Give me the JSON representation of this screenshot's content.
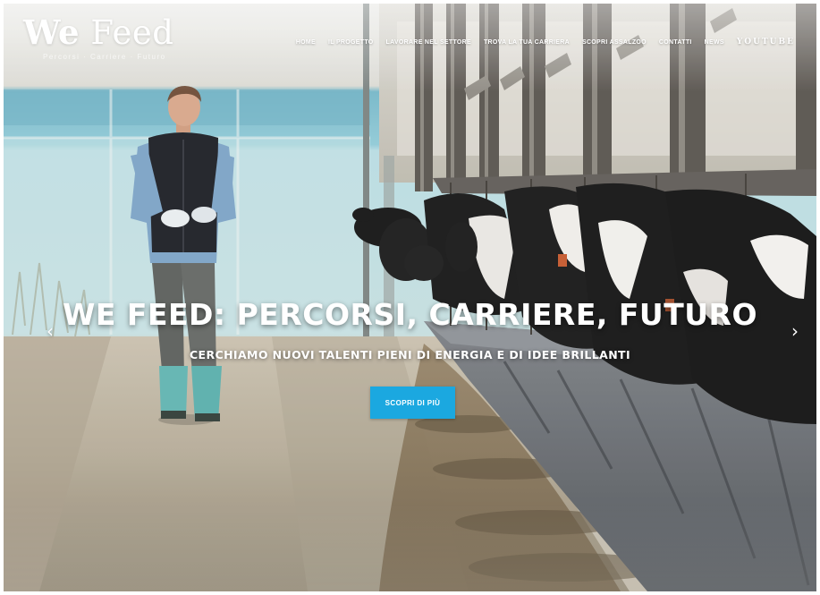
{
  "logo": {
    "brand_prefix": "We",
    "brand_suffix": "Feed",
    "tagline": "Percorsi · Carriere · Futuro"
  },
  "nav": {
    "items": [
      {
        "label": "Home"
      },
      {
        "label": "Il progetto"
      },
      {
        "label": "Lavorare nel settore"
      },
      {
        "label": "Trova la tua carriera"
      },
      {
        "label": "Scopri Assalzoo"
      },
      {
        "label": "Contatti"
      },
      {
        "label": "News"
      }
    ],
    "social_label": "YouTube"
  },
  "hero": {
    "headline": "WE FEED: PERCORSI, CARRIERE, FUTURO",
    "subline": "CERCHIAMO NUOVI TALENTI PIENI DI ENERGIA E DI IDEE BRILLANTI",
    "cta_label": "Scopri di più",
    "prev_arrow": "‹",
    "next_arrow": "›"
  },
  "colors": {
    "accent": "#1ba8e0",
    "text_on_image": "#ffffff"
  }
}
